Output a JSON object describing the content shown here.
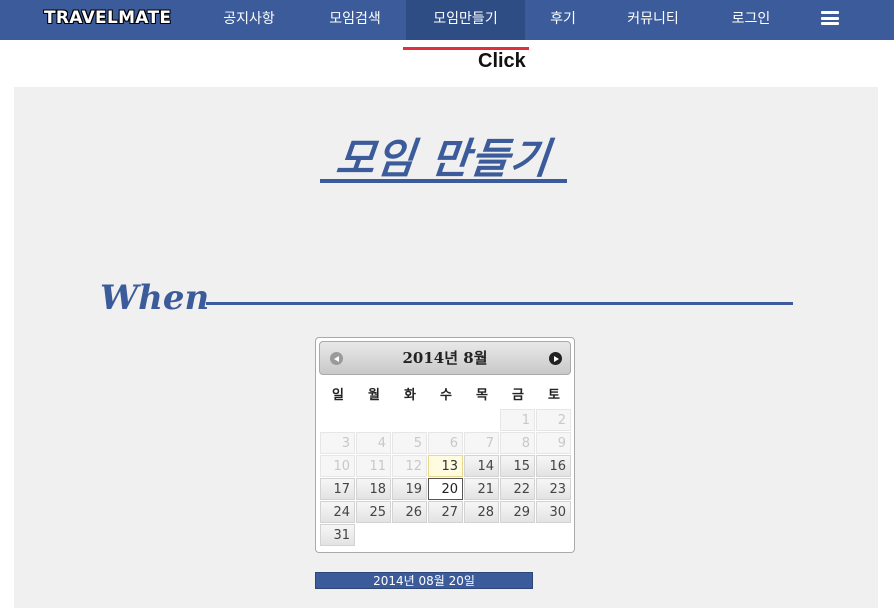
{
  "nav": {
    "logo": "TRAVELMATE",
    "items": [
      {
        "label": "공지사항"
      },
      {
        "label": "모임검색"
      },
      {
        "label": "모임만들기"
      },
      {
        "label": "후기"
      },
      {
        "label": "커뮤니티"
      },
      {
        "label": "로그인"
      }
    ],
    "active_index": 2,
    "menu_icon": "hamburger-icon"
  },
  "annotation": {
    "click_text": "Click"
  },
  "page": {
    "title": "모임 만들기",
    "section_when": "When"
  },
  "calendar": {
    "title": "2014년 8월",
    "prev_icon": "chevron-left-circle-icon",
    "next_icon": "chevron-right-circle-icon",
    "weekdays": [
      "일",
      "월",
      "화",
      "수",
      "목",
      "금",
      "토"
    ],
    "first_weekday_index": 5,
    "days_in_month": 31,
    "today": 13,
    "selected": 20
  },
  "date_input": {
    "value": "2014년 08월 20일"
  },
  "colors": {
    "brand": "#3b5b9a",
    "click_marker": "#e03040",
    "panel_bg": "#f0f0f0"
  }
}
